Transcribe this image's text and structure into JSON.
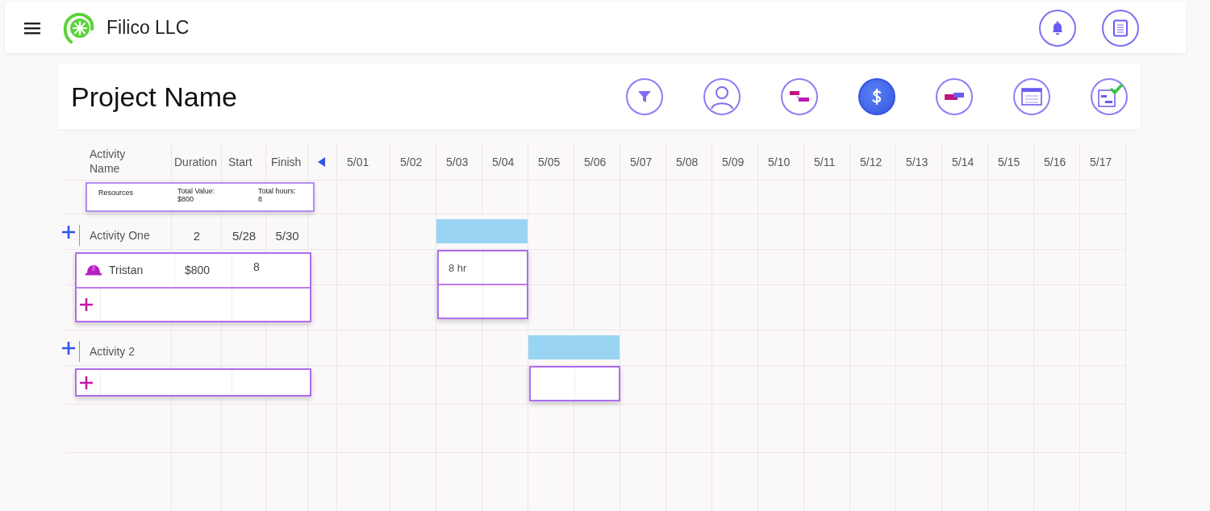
{
  "app_bar": {
    "company": "Filico LLC"
  },
  "project": {
    "title": "Project Name"
  },
  "tools": [
    {
      "kind": "filter",
      "selected": false
    },
    {
      "kind": "person",
      "selected": false
    },
    {
      "kind": "gantt",
      "selected": false
    },
    {
      "kind": "dollar",
      "selected": true
    },
    {
      "kind": "bar",
      "selected": false
    },
    {
      "kind": "window",
      "selected": false
    },
    {
      "kind": "checklist",
      "selected": false
    }
  ],
  "table": {
    "columns": [
      "Activity Name",
      "Duration",
      "Start",
      "Finish"
    ],
    "dates": [
      "5/01",
      "5/02",
      "5/03",
      "5/04",
      "5/05",
      "5/06",
      "5/07",
      "5/08",
      "5/09",
      "5/10",
      "5/11",
      "5/12",
      "5/13",
      "5/14",
      "5/15",
      "5/16",
      "5/17"
    ],
    "summary": {
      "label": "Resources",
      "total_value_label": "Total Value:",
      "total_value": "$800",
      "total_hours_label": "Total hours:",
      "total_hours": "8"
    },
    "activities": [
      {
        "name": "Activity One",
        "duration": "2",
        "start": "5/28",
        "finish": "5/30",
        "schedule": [
          false,
          false,
          true,
          true,
          false,
          false,
          false,
          false,
          false,
          false,
          false,
          false,
          false,
          false,
          false,
          false,
          false
        ],
        "resources": [
          {
            "name": "Tristan",
            "value": "$800",
            "hours": "8"
          }
        ],
        "hour_cells": [
          [
            {
              "text": "8 hr"
            },
            {}
          ],
          [
            {},
            {}
          ]
        ]
      },
      {
        "name": "Activity 2",
        "schedule": [
          false,
          false,
          false,
          false,
          true,
          true,
          false,
          false,
          false,
          false,
          false,
          false,
          false,
          false,
          false,
          false,
          false
        ],
        "hour_cells": [
          [
            {},
            {}
          ]
        ]
      }
    ]
  }
}
